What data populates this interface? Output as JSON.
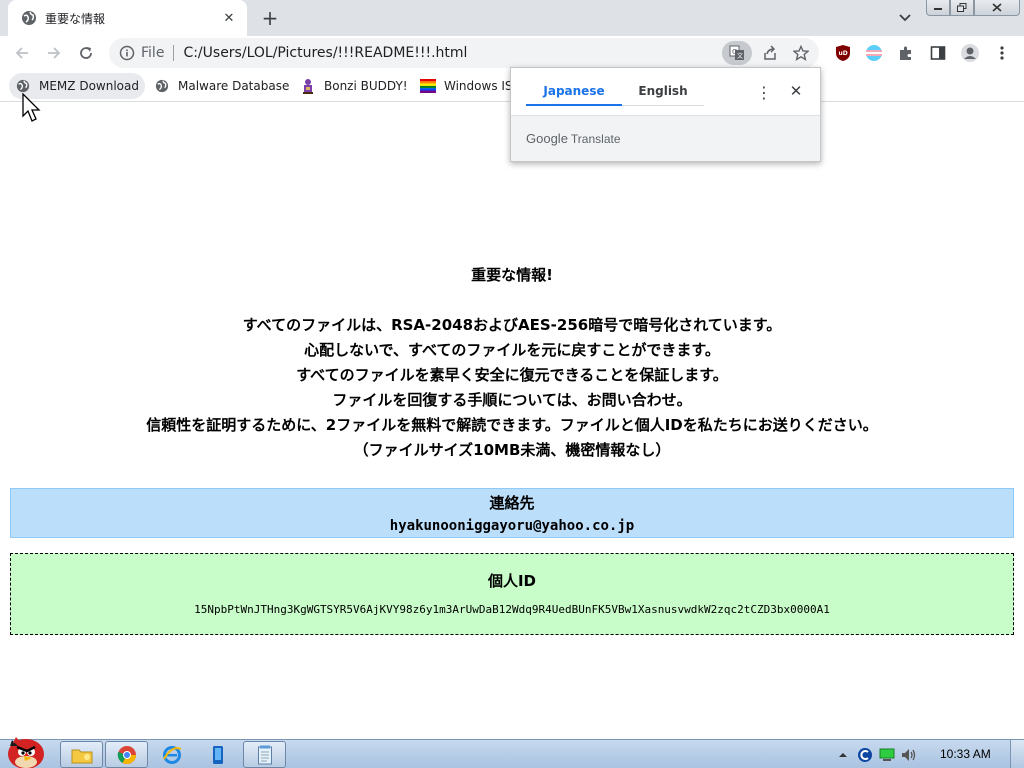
{
  "browser": {
    "tab": {
      "title": "重要な情報",
      "favicon": "globe-icon",
      "close_glyph": "✕"
    },
    "new_tab_glyph": "+",
    "window_controls": [
      "minimize",
      "restore",
      "close"
    ],
    "toolbar": {
      "back": "back-arrow-icon",
      "forward": "forward-arrow-icon",
      "reload": "reload-icon",
      "omnibox": {
        "scheme_label": "File",
        "url": "C:/Users/LOL/Pictures/!!!README!!!.html"
      },
      "extensions": [
        "ublock-icon",
        "flag-extension-icon",
        "puzzle-icon",
        "side-panel-icon",
        "profile-icon",
        "kebab-menu-icon"
      ]
    },
    "bookmarks": [
      {
        "label": "MEMZ Download",
        "icon": "globe-icon"
      },
      {
        "label": "Malware Database",
        "icon": "globe-icon"
      },
      {
        "label": "Bonzi BUDDY!",
        "icon": "bonzi-icon"
      },
      {
        "label": "Windows IS",
        "icon": "rainbow-flag-icon"
      }
    ]
  },
  "translate_popup": {
    "tabs": [
      {
        "label": "Japanese",
        "active": true
      },
      {
        "label": "English",
        "active": false
      }
    ],
    "menu_glyph": "⋮",
    "close_glyph": "✕",
    "footer_brand": "Google",
    "footer_product": "Translate"
  },
  "page": {
    "heading": "重要な情報!",
    "lines": [
      "すべてのファイルは、RSA-2048およびAES-256暗号で暗号化されています。",
      "心配しないで、すべてのファイルを元に戻すことができます。",
      "すべてのファイルを素早く安全に復元できることを保証します。",
      "ファイルを回復する手順については、お問い合わせ。",
      "信頼性を証明するために、2ファイルを無料で解読できます。ファイルと個人IDを私たちにお送りください。",
      "（ファイルサイズ10MB未満、機密情報なし）"
    ],
    "contact": {
      "title": "連絡先",
      "email": "hyakunooniggayoru@yahoo.co.jp",
      "bg_color": "#bbdefb"
    },
    "personal_id": {
      "title": "個人ID",
      "value": "15NpbPtWnJTHng3KgWGTSYR5V6AjKVY98z6y1m3ArUwDaB12Wdq9R4UedBUnFK5VBw1XasnusvwdkW2zqc2tCZD3bx0000A1",
      "bg_color": "#c8fcc8"
    }
  },
  "taskbar": {
    "start": "angry-bird-start-icon",
    "apps": [
      "explorer-icon",
      "chrome-icon",
      "ie-icon",
      "phone-app-icon",
      "notepad-icon"
    ],
    "tray": [
      "show-hidden-icons",
      "tray-app-icon",
      "network-icon",
      "volume-icon"
    ],
    "clock": "10:33 AM"
  }
}
